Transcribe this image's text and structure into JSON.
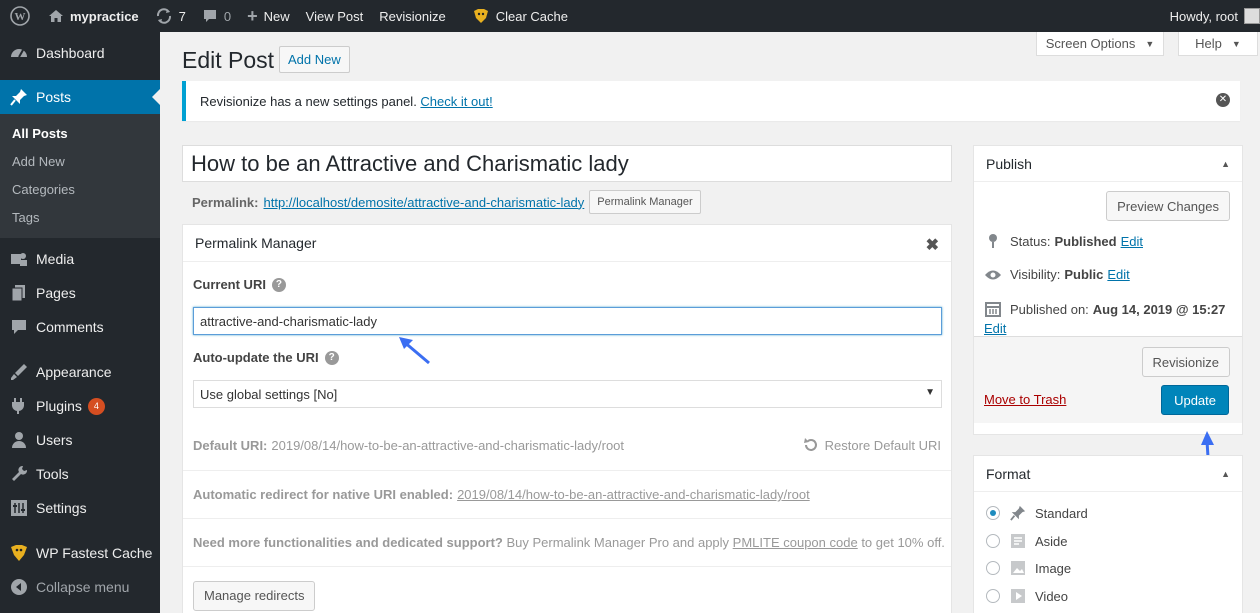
{
  "admin_bar": {
    "site_name": "mypractice",
    "updates_count": "7",
    "comments_count": "0",
    "new_label": "New",
    "view_post_label": "View Post",
    "revisionize_label": "Revisionize",
    "clear_cache_label": "Clear Cache",
    "howdy": "Howdy, root"
  },
  "sidebar": {
    "items": [
      {
        "label": "Dashboard",
        "icon": "dashboard-icon"
      },
      {
        "label": "Posts",
        "icon": "pin-icon"
      },
      {
        "label": "Media",
        "icon": "media-icon"
      },
      {
        "label": "Pages",
        "icon": "pages-icon"
      },
      {
        "label": "Comments",
        "icon": "comments-icon"
      },
      {
        "label": "Appearance",
        "icon": "appearance-icon"
      },
      {
        "label": "Plugins",
        "icon": "plugins-icon",
        "badge": "4"
      },
      {
        "label": "Users",
        "icon": "users-icon"
      },
      {
        "label": "Tools",
        "icon": "tools-icon"
      },
      {
        "label": "Settings",
        "icon": "settings-icon"
      },
      {
        "label": "WP Fastest Cache",
        "icon": "cheetah-icon"
      },
      {
        "label": "Collapse menu",
        "icon": "collapse-icon"
      }
    ],
    "posts_submenu": [
      "All Posts",
      "Add New",
      "Categories",
      "Tags"
    ]
  },
  "screen_options_label": "Screen Options",
  "help_label": "Help",
  "page_title": "Edit Post",
  "add_new_label": "Add New",
  "notice": {
    "plugin": "Revisionize",
    "text": " has a new settings panel. ",
    "link": "Check it out!"
  },
  "post_title": "How to be an Attractive and Charismatic lady",
  "permalink": {
    "label": "Permalink:",
    "url": "http://localhost/demosite/attractive-and-charismatic-lady",
    "button": "Permalink Manager"
  },
  "permalink_manager": {
    "title": "Permalink Manager",
    "current_uri_label": "Current URI",
    "current_uri_value": "attractive-and-charismatic-lady",
    "auto_update_label": "Auto-update the URI",
    "auto_update_value": "Use global settings [No]",
    "default_uri_label": "Default URI:",
    "default_uri_value": "2019/08/14/how-to-be-an-attractive-and-charismatic-lady/root",
    "restore_label": "Restore Default URI",
    "redirect_label": "Automatic redirect for native URI enabled:",
    "redirect_value": "2019/08/14/how-to-be-an-attractive-and-charismatic-lady/root",
    "promo_bold": "Need more functionalities and dedicated support?",
    "promo_text_1": " Buy Permalink Manager Pro and apply ",
    "promo_coupon": "PMLITE coupon code",
    "promo_text_2": " to get 10% off.",
    "manage_redirects": "Manage redirects"
  },
  "publish": {
    "title": "Publish",
    "preview_button": "Preview Changes",
    "status_label": "Status:",
    "status_value": "Published",
    "visibility_label": "Visibility:",
    "visibility_value": "Public",
    "published_on_label": "Published on:",
    "published_on_value": "Aug 14, 2019 @ 15:27",
    "edit_label": "Edit",
    "revisionize_button": "Revisionize",
    "trash_label": "Move to Trash",
    "update_button": "Update"
  },
  "format": {
    "title": "Format",
    "options": [
      {
        "label": "Standard",
        "icon": "pin-icon",
        "checked": true
      },
      {
        "label": "Aside",
        "icon": "aside-icon",
        "checked": false
      },
      {
        "label": "Image",
        "icon": "image-icon",
        "checked": false
      },
      {
        "label": "Video",
        "icon": "video-icon",
        "checked": false
      }
    ]
  },
  "colors": {
    "admin_bar": "#23282d",
    "accent": "#0073aa",
    "primary_button": "#0085ba",
    "annotation_arrow": "#3b6ef2"
  }
}
